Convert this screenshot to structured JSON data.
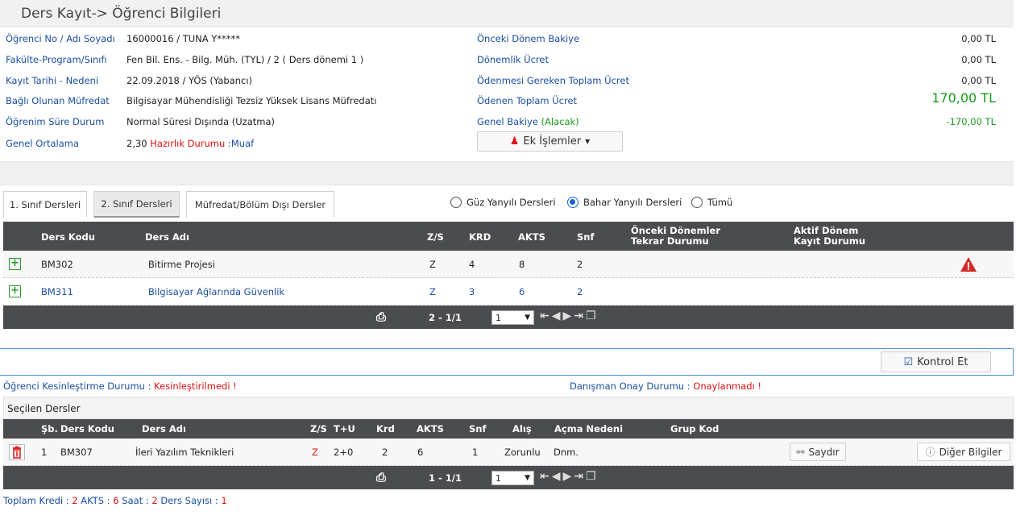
{
  "header": {
    "title": "Ders Kayıt-> Öğrenci Bilgileri"
  },
  "info_left": [
    {
      "label": "Öğrenci No / Adı Soyadı",
      "value": "16000016 / TUNA Y*****"
    },
    {
      "label": "Fakülte-Program/Sınıfı",
      "value": "Fen Bil. Ens. - Bilg. Müh. (TYL) / 2 ( Ders dönemi 1 )"
    },
    {
      "label": "Kayıt Tarihi - Nedeni",
      "value": "22.09.2018 / YÖS (Yabancı)"
    },
    {
      "label": "Bağlı Olunan Müfredat",
      "value": "Bilgisayar Mühendisliği Tezsiz Yüksek Lisans Müfredatı"
    },
    {
      "label": "Öğrenim Süre Durum",
      "value": "Normal Süresi Dışında (Uzatma)"
    },
    {
      "label": "Genel Ortalama",
      "value": "2,30",
      "extra_label": "Hazırlık Durumu :",
      "extra_value": "Muaf"
    }
  ],
  "info_right": [
    {
      "label": "Önceki Dönem Bakiye",
      "value": "0,00 TL"
    },
    {
      "label": "Dönemlik Ücret",
      "value": "0,00 TL"
    },
    {
      "label": "Ödenmesi Gereken Toplam Ücret",
      "value": "0,00 TL"
    },
    {
      "label": "Ödenen Toplam Ücret",
      "value": "170,00 TL"
    },
    {
      "label": "Genel Bakiye",
      "label_extra": "(Alacak)",
      "value": "-170,00 TL"
    }
  ],
  "ek_islemler_label": "Ek İşlemler",
  "tabs": [
    "1. Sınıf Dersleri",
    "2. Sınıf Dersleri",
    "Müfredat/Bölüm Dışı Dersler"
  ],
  "radios": [
    "Güz Yanyılı Dersleri",
    "Bahar Yanyılı Dersleri",
    "Tümü"
  ],
  "course_table": {
    "headers": [
      "Ders Kodu",
      "Ders Adı",
      "Z/S",
      "KRD",
      "AKTS",
      "Snf",
      "Önceki Dönemler",
      "Tekrar Durumu",
      "Aktif Dönem",
      "Kayıt Durumu"
    ],
    "rows": [
      {
        "code": "BM302",
        "name": "Bitirme Projesi",
        "zs": "Z",
        "krd": "4",
        "akts": "8",
        "snf": "2"
      },
      {
        "code": "BM311",
        "name": "Bilgisayar Ağlarında Güvenlik",
        "zs": "Z",
        "krd": "3",
        "akts": "6",
        "snf": "2"
      }
    ],
    "pager": {
      "range": "2 - 1/1",
      "page": "1"
    }
  },
  "kontrol_et_label": "Kontrol Et",
  "status": {
    "kesin_label": "Öğrenci Kesinleştirme Durumu :",
    "kesin_value": "Kesinleştirilmedi !",
    "danisman_label": "Danışman Onay Durumu :",
    "danisman_value": "Onaylanmadı !"
  },
  "selected": {
    "title": "Seçilen Dersler",
    "headers": [
      "Şb.",
      "Ders Kodu",
      "Ders Adı",
      "Z/S",
      "T+U",
      "Krd",
      "AKTS",
      "Snf",
      "Alış",
      "Açma Nedeni",
      "Grup Kod"
    ],
    "rows": [
      {
        "sb": "1",
        "code": "BM307",
        "name": "İleri Yazılım Teknikleri",
        "zs": "Z",
        "tu": "2+0",
        "krd": "2",
        "akts": "6",
        "snf": "1",
        "alis": "Zorunlu",
        "neden": "Dnm.",
        "saydir": "Saydır",
        "diger": "Diğer Bilgiler"
      }
    ],
    "pager": {
      "range": "1 - 1/1",
      "page": "1"
    }
  },
  "totals": {
    "kredi_label": "Toplam Kredi :",
    "kredi": "2",
    "akts_label": "AKTS :",
    "akts": "6",
    "saat_label": "Saat :",
    "saat": "2",
    "ders_label": "Ders Sayısı :",
    "ders": "1"
  }
}
